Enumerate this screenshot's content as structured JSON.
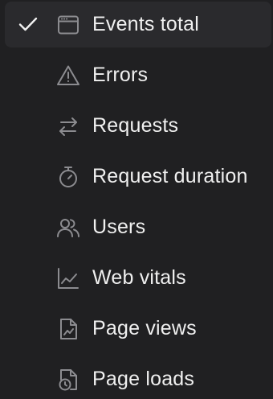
{
  "menu": {
    "items": [
      {
        "label": "Events total",
        "icon": "browser-window-icon",
        "selected": true
      },
      {
        "label": "Errors",
        "icon": "warning-triangle-icon",
        "selected": false
      },
      {
        "label": "Requests",
        "icon": "arrows-left-right-icon",
        "selected": false
      },
      {
        "label": "Request duration",
        "icon": "stopwatch-icon",
        "selected": false
      },
      {
        "label": "Users",
        "icon": "users-icon",
        "selected": false
      },
      {
        "label": "Web vitals",
        "icon": "line-chart-icon",
        "selected": false
      },
      {
        "label": "Page views",
        "icon": "document-chart-icon",
        "selected": false
      },
      {
        "label": "Page loads",
        "icon": "document-clock-icon",
        "selected": false
      }
    ]
  },
  "colors": {
    "background": "#202022",
    "selected_background": "#2a2a2d",
    "text": "#f0f0f0",
    "icon": "#8c8c90",
    "check": "#f0f0f0"
  }
}
